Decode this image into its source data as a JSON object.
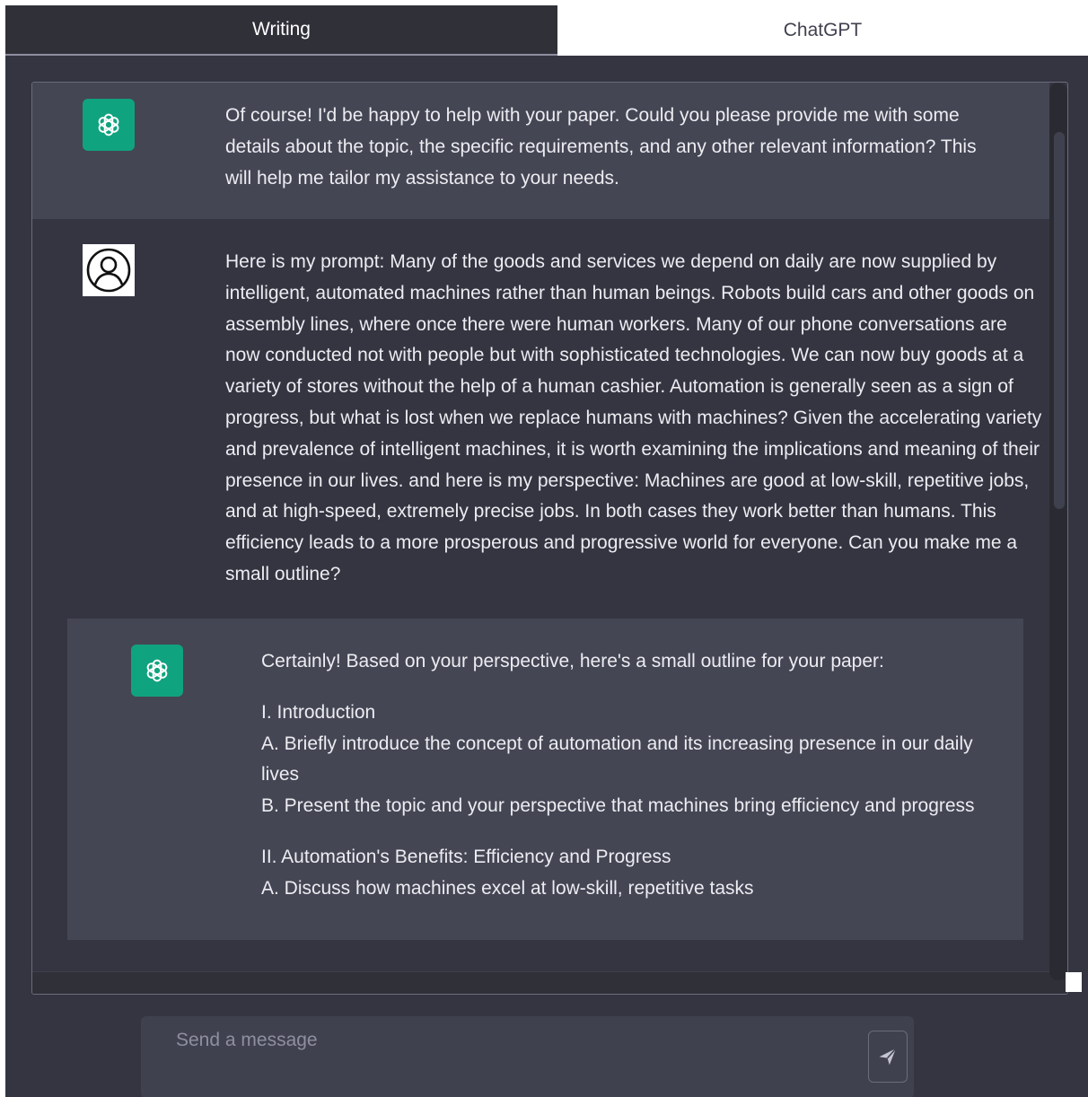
{
  "tabs": [
    {
      "label": "Writing",
      "active": true
    },
    {
      "label": "ChatGPT",
      "active": false
    }
  ],
  "messages": {
    "assistant_1": {
      "role": "assistant",
      "avatar_icon": "openai-logo-icon",
      "text": "Of course! I'd be happy to help with your paper. Could you please provide me with some details about the topic, the specific requirements, and any other relevant information? This will help me tailor my assistance to your needs."
    },
    "user_1": {
      "role": "user",
      "avatar_icon": "user-avatar-icon",
      "text": "Here is my prompt: Many of the goods and services we depend on daily are now supplied by intelligent, automated machines rather than human beings. Robots build cars and other goods on assembly lines, where once there were human workers. Many of our phone conversations are now conducted not with people but with sophisticated technologies. We can now buy goods at a variety of stores without the help of a human cashier. Automation is generally seen as a sign of progress, but what is lost when we replace humans with machines? Given the accelerating variety and prevalence of intelligent machines, it is worth examining the implications and meaning of their presence in our lives. and here is my perspective: Machines are good at low-skill, repetitive jobs, and at high-speed, extremely precise jobs. In both cases they work better than humans. This efficiency leads to a more prosperous and progressive world for everyone. Can you make me a small outline?"
    },
    "assistant_2": {
      "role": "assistant",
      "avatar_icon": "openai-logo-icon",
      "intro": "Certainly! Based on your perspective, here's a small outline for your paper:",
      "outline": [
        {
          "heading": "I. Introduction",
          "items": [
            "A. Briefly introduce the concept of automation and its increasing presence in our daily lives",
            "B. Present the topic and your perspective that machines bring efficiency and progress"
          ]
        },
        {
          "heading": "II. Automation's Benefits: Efficiency and Progress",
          "items": [
            "A. Discuss how machines excel at low-skill, repetitive tasks"
          ]
        }
      ]
    }
  },
  "composer": {
    "placeholder": "Send a message",
    "value": "",
    "send_icon": "paper-plane-icon"
  },
  "colors": {
    "background": "#343541",
    "assistant_row": "#444654",
    "accent": "#10a37f",
    "text": "#ececf1",
    "placeholder": "#8e8ea0"
  }
}
